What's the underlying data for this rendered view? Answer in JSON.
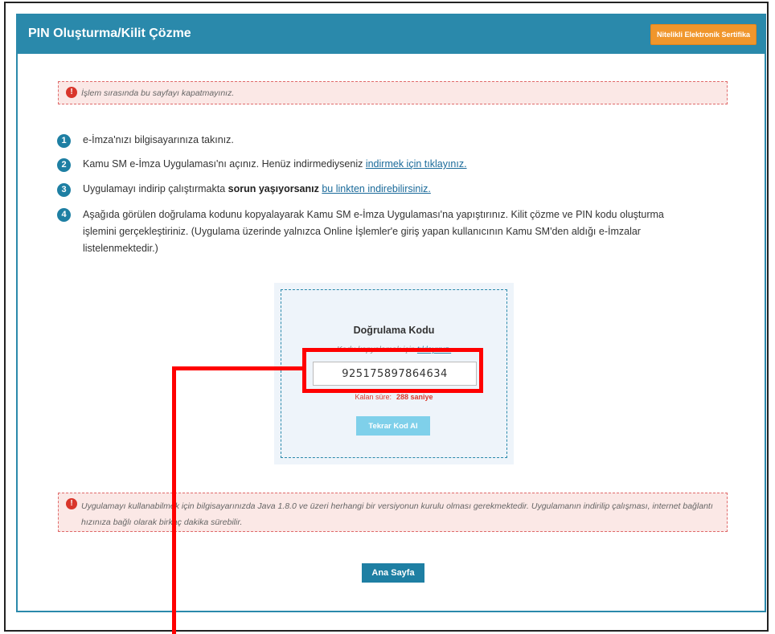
{
  "header": {
    "title": "PIN Oluşturma/Kilit Çözme",
    "badge": "Nitelikli Elektronik Sertifika"
  },
  "alerts": {
    "top": "İşlem sırasında bu sayfayı kapatmayınız.",
    "bottom": "Uygulamayı kullanabilmek için bilgisayarınızda Java 1.8.0 ve üzeri herhangi bir versiyonun kurulu olması gerekmektedir. Uygulamanın indirilip çalışması, internet bağlantı hızınıza bağlı olarak birkaç dakika sürebilir.",
    "icon": "exclamation-circle-icon"
  },
  "steps": [
    {
      "num": "1",
      "text": "e-İmza'nızı bilgisayarınıza takınız."
    },
    {
      "num": "2",
      "text": "Kamu SM e-İmza Uygulaması'nı açınız. Henüz indirmediyseniz ",
      "link": "indirmek için tıklayınız."
    },
    {
      "num": "3",
      "text": "Uygulamayı indirip çalıştırmakta ",
      "bold": "sorun yaşıyorsanız",
      "link": "bu linkten indirebilirsiniz."
    },
    {
      "num": "4",
      "text": "Aşağıda görülen doğrulama kodunu kopyalayarak Kamu SM e-İmza Uygulaması'na yapıştırınız. Kilit çözme ve PIN kodu oluşturma işlemini gerçekleştiriniz. (Uygulama üzerinde yalnızca Online İşlemler'e giriş yapan kullanıcının Kamu SM'den aldığı e-İmzalar listelenmektedir.)"
    }
  ],
  "verification": {
    "title": "Doğrulama Kodu",
    "copy_hint_prefix": "Kodu kopyalamak için ",
    "copy_hint_link": "tıklayınız.",
    "code": "925175897864634",
    "time_label": "Kalan süre:",
    "time_value": "288",
    "time_unit": "saniye",
    "retry_label": "Tekrar Kod Al"
  },
  "home_button": "Ana Sayfa",
  "colors": {
    "header": "#2a89ab",
    "badge": "#f0962c",
    "alert_bg": "#fbe8e6",
    "alert_border": "#e06a6a",
    "highlight": "#ff0000"
  }
}
